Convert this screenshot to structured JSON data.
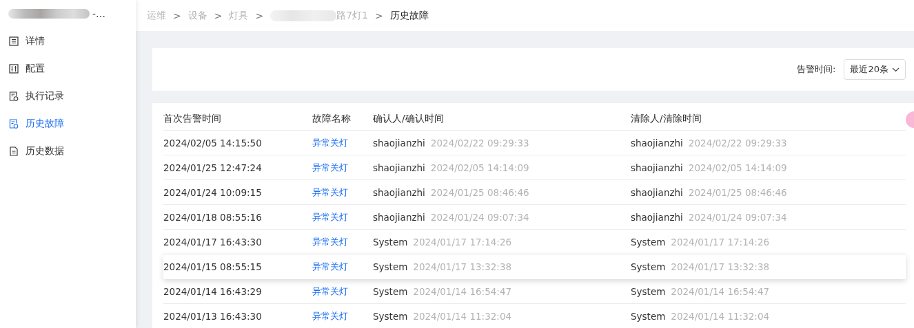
{
  "sidebar": {
    "title": "-…",
    "items": [
      {
        "label": "详情",
        "kind": "list",
        "selected": false
      },
      {
        "label": "配置",
        "kind": "sliders",
        "selected": false
      },
      {
        "label": "执行记录",
        "kind": "record",
        "selected": false
      },
      {
        "label": "历史故障",
        "kind": "record",
        "selected": true
      },
      {
        "label": "历史数据",
        "kind": "file",
        "selected": false
      }
    ]
  },
  "breadcrumb": [
    {
      "label": "运维",
      "current": false,
      "redacted": false
    },
    {
      "separator": ">",
      "label": "设备",
      "current": false,
      "redacted": false
    },
    {
      "separator": ">",
      "label": "灯具",
      "current": false,
      "redacted": false
    },
    {
      "separator": ">",
      "label": "路7灯1",
      "current": false,
      "redacted": true
    },
    {
      "separator": ">",
      "label": "历史故障",
      "current": true,
      "redacted": false
    }
  ],
  "filter": {
    "label": "告警时间:",
    "value": "最近20条"
  },
  "table": {
    "columns": [
      "首次告警时间",
      "故障名称",
      "确认人/确认时间",
      "清除人/清除时间"
    ],
    "rows": [
      {
        "first_time": "2024/02/05 14:15:50",
        "fault": "异常关灯",
        "confirmer": "shaojianzhi",
        "confirm_time": "2024/02/22 09:29:33",
        "clearer": "shaojianzhi",
        "clear_time": "2024/02/22 09:29:33",
        "selected": false
      },
      {
        "first_time": "2024/01/25 12:47:24",
        "fault": "异常关灯",
        "confirmer": "shaojianzhi",
        "confirm_time": "2024/02/05 14:14:09",
        "clearer": "shaojianzhi",
        "clear_time": "2024/02/05 14:14:09",
        "selected": false
      },
      {
        "first_time": "2024/01/24 10:09:15",
        "fault": "异常关灯",
        "confirmer": "shaojianzhi",
        "confirm_time": "2024/01/25 08:46:46",
        "clearer": "shaojianzhi",
        "clear_time": "2024/01/25 08:46:46",
        "selected": false
      },
      {
        "first_time": "2024/01/18 08:55:16",
        "fault": "异常关灯",
        "confirmer": "shaojianzhi",
        "confirm_time": "2024/01/24 09:07:34",
        "clearer": "shaojianzhi",
        "clear_time": "2024/01/24 09:07:34",
        "selected": false
      },
      {
        "first_time": "2024/01/17 16:43:30",
        "fault": "异常关灯",
        "confirmer": "System",
        "confirm_time": "2024/01/17 17:14:26",
        "clearer": "System",
        "clear_time": "2024/01/17 17:14:26",
        "selected": false
      },
      {
        "first_time": "2024/01/15 08:55:15",
        "fault": "异常关灯",
        "confirmer": "System",
        "confirm_time": "2024/01/17 13:32:38",
        "clearer": "System",
        "clear_time": "2024/01/17 13:32:38",
        "selected": true
      },
      {
        "first_time": "2024/01/14 16:43:29",
        "fault": "异常关灯",
        "confirmer": "System",
        "confirm_time": "2024/01/14 16:54:47",
        "clearer": "System",
        "clear_time": "2024/01/14 16:54:47",
        "selected": false
      },
      {
        "first_time": "2024/01/13 16:43:30",
        "fault": "异常关灯",
        "confirmer": "System",
        "confirm_time": "2024/01/14 11:32:04",
        "clearer": "System",
        "clear_time": "2024/01/14 11:32:04",
        "selected": false
      }
    ]
  }
}
